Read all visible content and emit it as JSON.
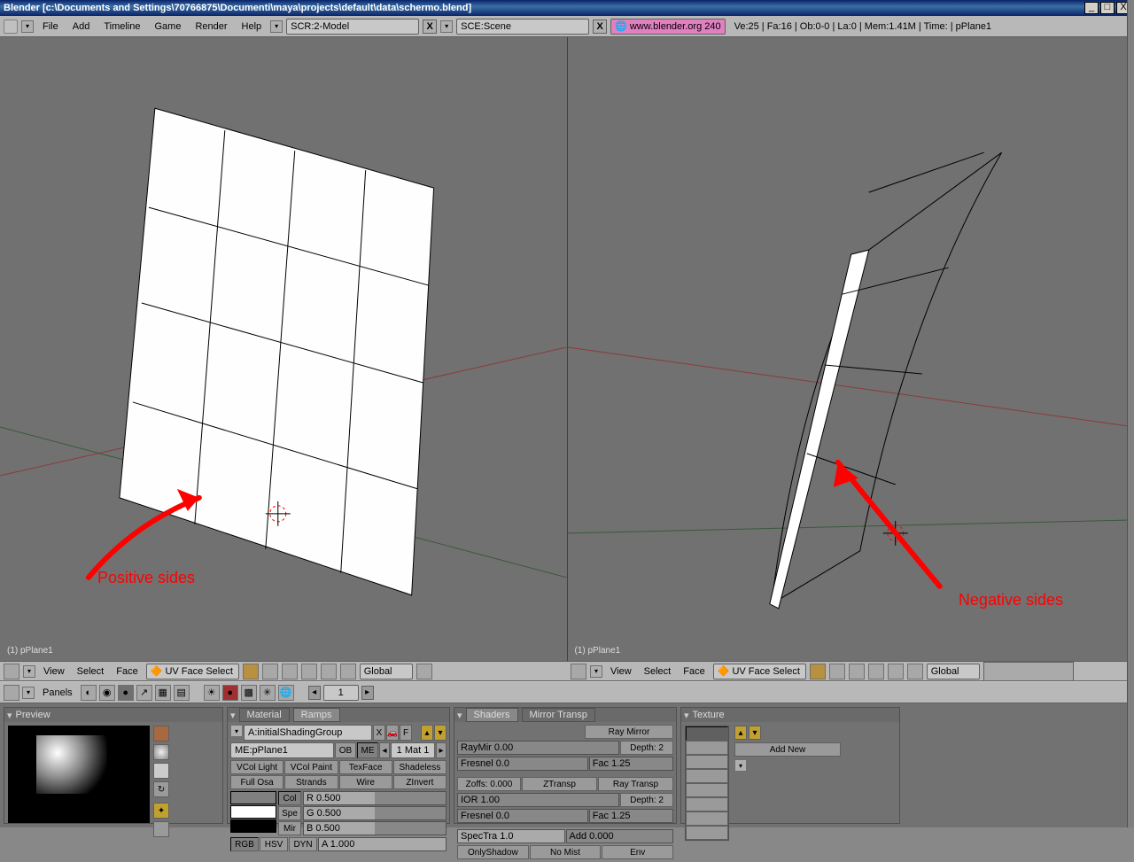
{
  "window": {
    "title": "Blender [c:\\Documents and Settings\\70766875\\Documenti\\maya\\projects\\default\\data\\schermo.blend]",
    "min": "_",
    "max": "□",
    "close": "X"
  },
  "menu": {
    "items": [
      "File",
      "Add",
      "Timeline",
      "Game",
      "Render",
      "Help"
    ],
    "scr": "SCR:2-Model",
    "sce": "SCE:Scene",
    "url": "www.blender.org 240",
    "stats": "Ve:25 | Fa:16 | Ob:0-0 | La:0 | Mem:1.41M | Time:  | pPlane1"
  },
  "viewport": {
    "left_label": "(1) pPlane1",
    "right_label": "(1) pPlane1",
    "ann_left": "Positive sides",
    "ann_right": "Negative sides"
  },
  "footer3d_left": {
    "view": "View",
    "select": "Select",
    "face": "Face",
    "mode": "UV Face Select",
    "orient": "Global"
  },
  "footer3d_right": {
    "view": "View",
    "select": "Select",
    "face": "Face",
    "mode": "UV Face Select",
    "orient": "Global"
  },
  "panelbar": {
    "panels": "Panels",
    "num": "1"
  },
  "preview": {
    "title": "Preview"
  },
  "material": {
    "tab1": "Material",
    "tab2": "Ramps",
    "link": "A:initialShadingGroup",
    "me": "ME:pPlane1",
    "ob": "OB",
    "meb": "ME",
    "mat": "1 Mat 1",
    "r1": [
      "VCol Light",
      "VCol Paint",
      "TexFace",
      "Shadeless"
    ],
    "r2": [
      "Full Osa",
      "Strands",
      "Wire",
      "ZInvert"
    ],
    "col": "Col",
    "spe": "Spe",
    "mir": "Mir",
    "rv": "R 0.500",
    "gv": "G 0.500",
    "bv": "B 0.500",
    "rgb": "RGB",
    "hsv": "HSV",
    "dyn": "DYN",
    "a": "A 1.000"
  },
  "shaders": {
    "tab1": "Shaders",
    "tab2": "Mirror Transp",
    "raymirror": "Ray Mirror",
    "raymir": "RayMir 0.00",
    "depth1": "Depth: 2",
    "fresnel1": "Fresnel 0.0",
    "fac1": "Fac 1.25",
    "zoffs": "Zoffs: 0.000",
    "ztransp": "ZTransp",
    "raytransp": "Ray Transp",
    "ior": "IOR 1.00",
    "depth2": "Depth: 2",
    "fresnel2": "Fresnel 0.0",
    "fac2": "Fac 1.25",
    "spectra": "SpecTra 1.0",
    "add": "Add 0.000",
    "onlyshadow": "OnlyShadow",
    "nomist": "No Mist",
    "env": "Env"
  },
  "texture": {
    "title": "Texture",
    "addnew": "Add New"
  }
}
